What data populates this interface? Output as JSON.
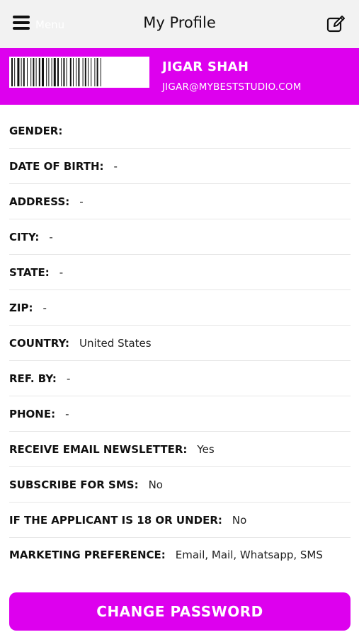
{
  "topbar": {
    "menu_label": "Menu",
    "title": "My Profile",
    "menu_icon": "hamburger-icon",
    "edit_icon": "edit-icon"
  },
  "profile": {
    "name": "JIGAR SHAH",
    "email": "JIGAR@MYBESTSTUDIO.COM"
  },
  "fields": [
    {
      "label": "GENDER:",
      "value": ""
    },
    {
      "label": "DATE OF BIRTH:",
      "value": "-"
    },
    {
      "label": "ADDRESS:",
      "value": "-"
    },
    {
      "label": "CITY:",
      "value": "-"
    },
    {
      "label": "STATE:",
      "value": "-"
    },
    {
      "label": "ZIP:",
      "value": "-"
    },
    {
      "label": "COUNTRY:",
      "value": "United States"
    },
    {
      "label": "REF. BY:",
      "value": "-"
    },
    {
      "label": "PHONE:",
      "value": "-"
    },
    {
      "label": "RECEIVE EMAIL NEWSLETTER:",
      "value": "Yes"
    },
    {
      "label": "SUBSCRIBE FOR SMS:",
      "value": "No"
    },
    {
      "label": "IF THE APPLICANT IS 18 OR UNDER:",
      "value": "No"
    },
    {
      "label": "MARKETING PREFERENCE:",
      "value": "Email, Mail, Whatsapp, SMS"
    }
  ],
  "actions": {
    "change_password": "CHANGE PASSWORD"
  },
  "colors": {
    "accent": "#dd00ee",
    "topbar_bg": "#f2f2f2"
  }
}
